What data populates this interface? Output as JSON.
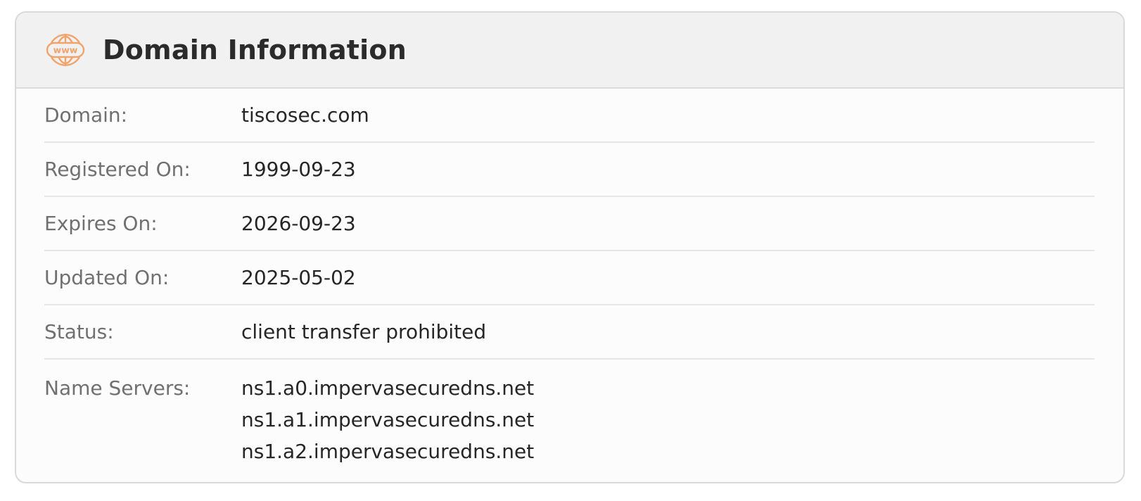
{
  "header": {
    "title": "Domain Information",
    "icon": "www-globe-icon",
    "icon_text": "www",
    "icon_color": "#f0a36b"
  },
  "rows": [
    {
      "label": "Domain:",
      "value": "tiscosec.com"
    },
    {
      "label": "Registered On:",
      "value": "1999-09-23"
    },
    {
      "label": "Expires On:",
      "value": "2026-09-23"
    },
    {
      "label": "Updated On:",
      "value": "2025-05-02"
    },
    {
      "label": "Status:",
      "value": "client transfer prohibited"
    }
  ],
  "name_servers": {
    "label": "Name Servers:",
    "values": [
      "ns1.a0.impervasecuredns.net",
      "ns1.a1.impervasecuredns.net",
      "ns1.a2.impervasecuredns.net"
    ]
  }
}
